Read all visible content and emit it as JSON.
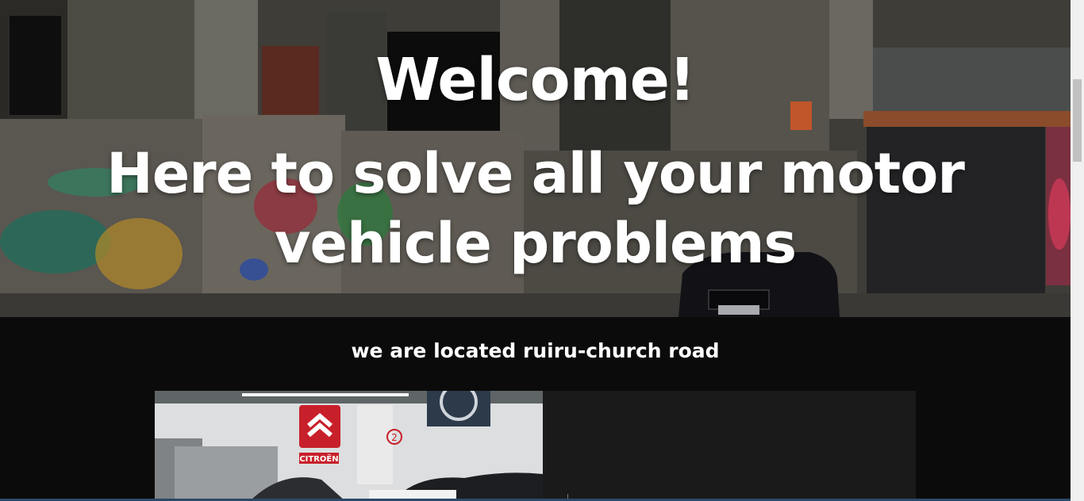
{
  "hero": {
    "welcome": "Welcome!",
    "tagline": "Here to solve all your motor vehicle problems"
  },
  "location": {
    "text": "we are located ruiru-church road"
  },
  "card": {
    "photo_signs": {
      "brand": "CITROËN",
      "bay_number": "2"
    }
  },
  "colors": {
    "background": "#0b0b0b",
    "card_body": "#1a1a1a",
    "heading_text": "#ffffff",
    "citroen_red": "#c8202a"
  }
}
